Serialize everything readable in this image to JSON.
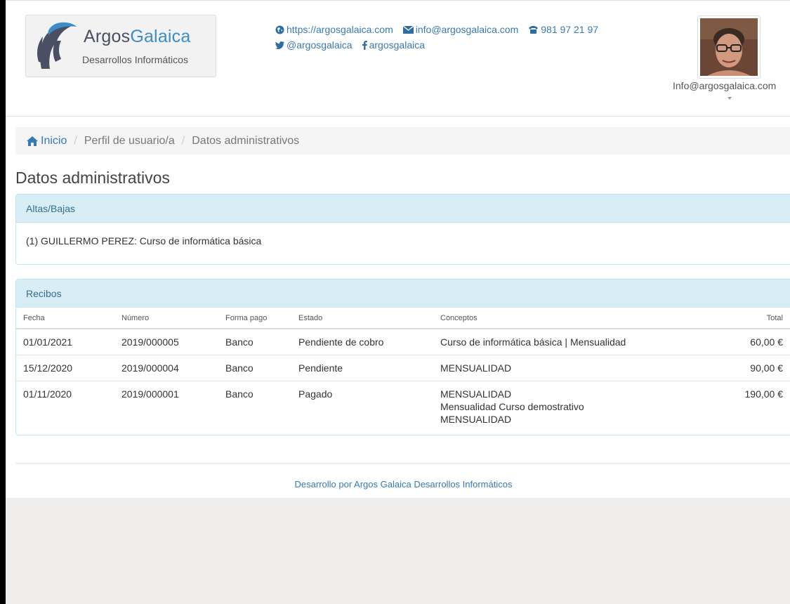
{
  "brand": {
    "name_part1": "Argos",
    "name_part2": "Galaica",
    "subtitle": "Desarrollos Informáticos"
  },
  "contacts": {
    "website": "https://argosgalaica.com",
    "email": "info@argosgalaica.com",
    "phone": "981 97 21 97",
    "twitter": "@argosgalaica",
    "facebook": "argosgalaica"
  },
  "user": {
    "email": "Info@argosgalaica.com"
  },
  "breadcrumb": {
    "home": "Inicio",
    "item1": "Perfil de usuario/a",
    "item2": "Datos administrativos"
  },
  "page_title": "Datos administrativos",
  "altas": {
    "heading": "Altas/Bajas",
    "entry": "(1) GUILLERMO PEREZ: Curso de informática básica"
  },
  "recibos": {
    "heading": "Recibos",
    "columns": [
      "Fecha",
      "Número",
      "Forma pago",
      "Estado",
      "Conceptos",
      "Total"
    ],
    "rows": [
      {
        "fecha": "01/01/2021",
        "numero": "2019/000005",
        "forma": "Banco",
        "estado": "Pendiente de cobro",
        "conceptos": [
          "Curso de informática básica | Mensualidad"
        ],
        "total": "60,00 €"
      },
      {
        "fecha": "15/12/2020",
        "numero": "2019/000004",
        "forma": "Banco",
        "estado": "Pendiente",
        "conceptos": [
          "MENSUALIDAD"
        ],
        "total": "90,00 €"
      },
      {
        "fecha": "01/11/2020",
        "numero": "2019/000001",
        "forma": "Banco",
        "estado": "Pagado",
        "conceptos": [
          "MENSUALIDAD",
          "Mensualidad Curso demostrativo",
          "MENSUALIDAD"
        ],
        "total": "190,00 €"
      }
    ]
  },
  "footer": "Desarrollo por Argos Galaica Desarrollos Informáticos",
  "colors": {
    "link": "#337ab7",
    "panel_heading_bg": "#d9edf7",
    "panel_heading_text": "#31708f",
    "panel_border": "#bce8f1",
    "page_bg": "#f0eded"
  },
  "icons": {
    "website": "globe-icon",
    "email": "envelope-icon",
    "phone": "phone-icon",
    "twitter": "twitter-icon",
    "facebook": "facebook-icon",
    "home": "home-icon"
  }
}
